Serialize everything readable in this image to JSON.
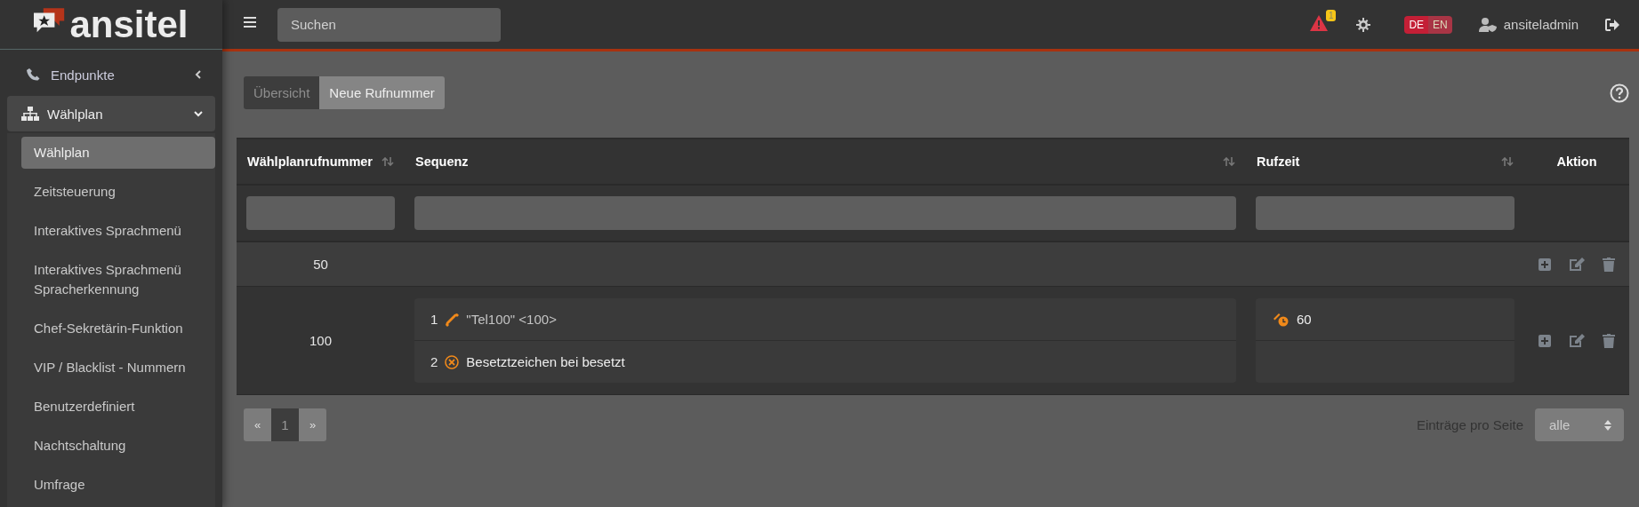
{
  "logo": {
    "text": "ansitel"
  },
  "header": {
    "search": {
      "placeholder": "Suchen"
    },
    "alert_count": "1",
    "languages": [
      {
        "label": "DE",
        "selected": true
      },
      {
        "label": "EN",
        "selected": false
      }
    ],
    "user": "ansiteladmin"
  },
  "sidebar": {
    "items": [
      {
        "label": "Endpunkte",
        "expanded": false
      },
      {
        "label": "Wählplan",
        "expanded": true,
        "children": [
          {
            "label": "Wählplan",
            "selected": true
          },
          {
            "label": "Zeitsteuerung",
            "selected": false
          },
          {
            "label": "Interaktives Sprachmenü",
            "selected": false
          },
          {
            "label": "Interaktives Sprachmenü Spracherkennung",
            "selected": false
          },
          {
            "label": "Chef-Sekretärin-Funktion",
            "selected": false
          },
          {
            "label": "VIP / Blacklist - Nummern",
            "selected": false
          },
          {
            "label": "Benutzerdefiniert",
            "selected": false
          },
          {
            "label": "Nachtschaltung",
            "selected": false
          },
          {
            "label": "Umfrage",
            "selected": false
          }
        ]
      }
    ]
  },
  "tabs": [
    {
      "label": "Übersicht",
      "selected": false
    },
    {
      "label": "Neue Rufnummer",
      "selected": true
    }
  ],
  "table": {
    "columns": [
      {
        "label": "Wählplanrufnummer",
        "sortable": true
      },
      {
        "label": "Sequenz",
        "sortable": true
      },
      {
        "label": "Rufzeit",
        "sortable": true
      },
      {
        "label": "Aktion",
        "sortable": false
      }
    ],
    "rows": [
      {
        "number": "50",
        "sequence": [],
        "ring_times": []
      },
      {
        "number": "100",
        "sequence": [
          {
            "index": "1",
            "kind": "call",
            "text": "\"Tel100\" <100>"
          },
          {
            "index": "2",
            "kind": "busy",
            "text": "Besetztzeichen bei besetzt"
          }
        ],
        "ring_times": [
          "60"
        ]
      }
    ]
  },
  "pagination": {
    "prev": "«",
    "pages": [
      {
        "label": "1",
        "selected": true
      }
    ],
    "next": "»"
  },
  "page_size": {
    "label": "Einträge pro Seite",
    "value": "alle"
  }
}
